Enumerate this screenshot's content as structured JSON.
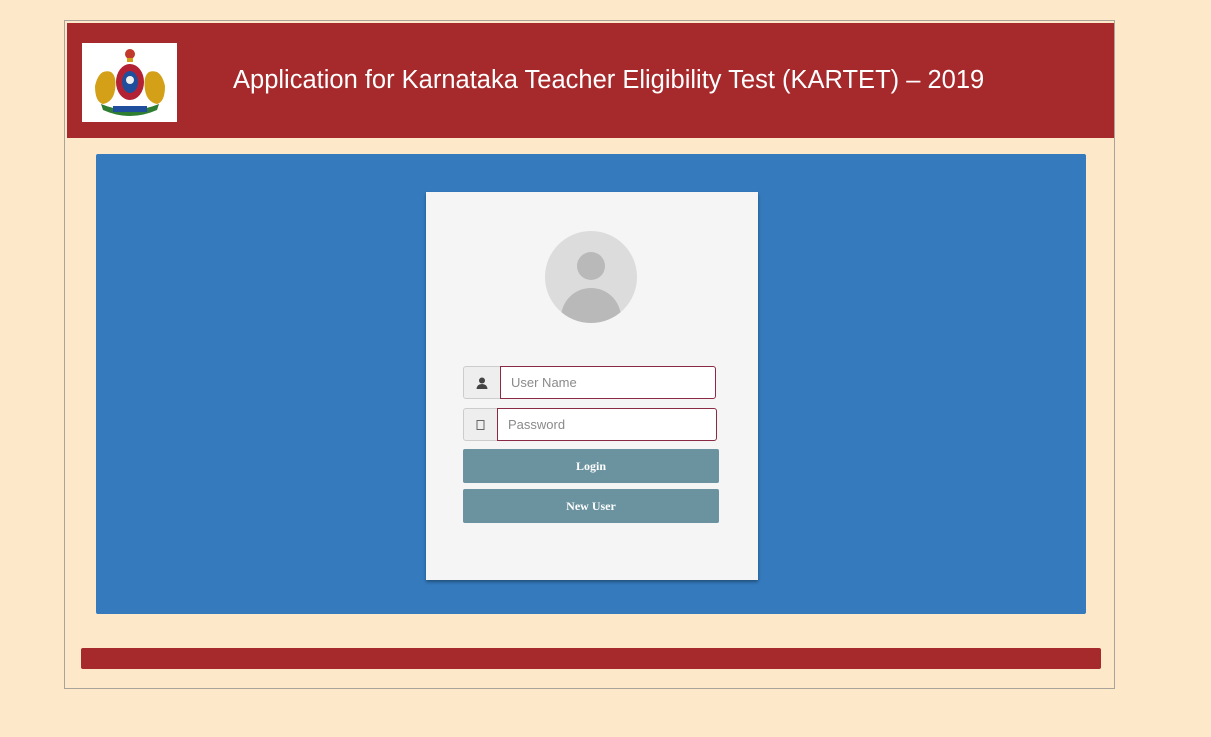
{
  "header": {
    "title": "Application for Karnataka Teacher Eligibility Test (KARTET) – 2019",
    "emblem_icon": "karnataka-emblem-icon"
  },
  "login": {
    "username_placeholder": "User Name",
    "password_placeholder": "Password",
    "login_label": "Login",
    "new_user_label": "New User",
    "user_icon": "user-icon",
    "lock_icon": "lock-icon"
  },
  "colors": {
    "header_bg": "#a6292b",
    "panel_bg": "#347abd",
    "page_bg": "#fde8c9",
    "button_bg": "#6a929f",
    "input_border": "#8b2a45"
  }
}
